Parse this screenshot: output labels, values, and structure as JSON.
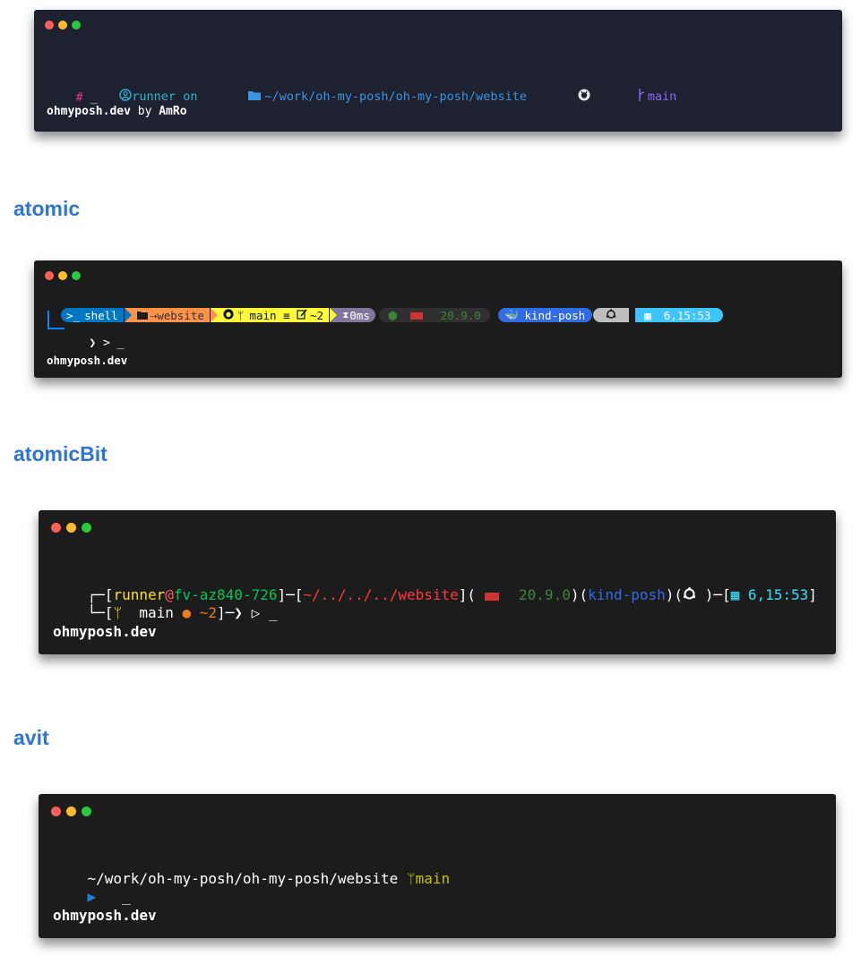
{
  "terminal1": {
    "user": "runner",
    "on": " on ",
    "path": "~/work/oh-my-posh/oh-my-posh/website",
    "branch": "main",
    "prompt_char": "#",
    "cursor": "_",
    "site": "ohmyposh.dev",
    "by": " by ",
    "author": "AmRo"
  },
  "theme2": {
    "name": "atomic",
    "shell": "shell",
    "path": "website",
    "branch": "main",
    "branch_status": "≡",
    "changes": "~2",
    "exec_time": "0ms",
    "node_version": "20.9.0",
    "kube_context": "kind-posh",
    "time": "6,15:53",
    "prompt_char": ">",
    "cursor": "_",
    "site": "ohmyposh.dev"
  },
  "theme3": {
    "name": "atomicBit",
    "user": "runner",
    "at": "@",
    "host": "fv-az840-726",
    "path": "~/../../../website",
    "node_version": "20.9.0",
    "kube_context": "kind-posh",
    "time": "6,15:53",
    "branch": "main",
    "changes": "~2",
    "cursor": "_",
    "site": "ohmyposh.dev"
  },
  "theme4": {
    "name": "avit",
    "path": "~/work/oh-my-posh/oh-my-posh/website",
    "branch": "main",
    "cursor": "_",
    "site": "ohmyposh.dev"
  },
  "colors": {
    "dot_red": "#ff5f56",
    "dot_yellow": "#ffbd2e",
    "dot_green": "#27c93f",
    "heading": "#2e75d6",
    "term1_bg": "#1d2130",
    "term_bg": "#1c1c1c"
  }
}
